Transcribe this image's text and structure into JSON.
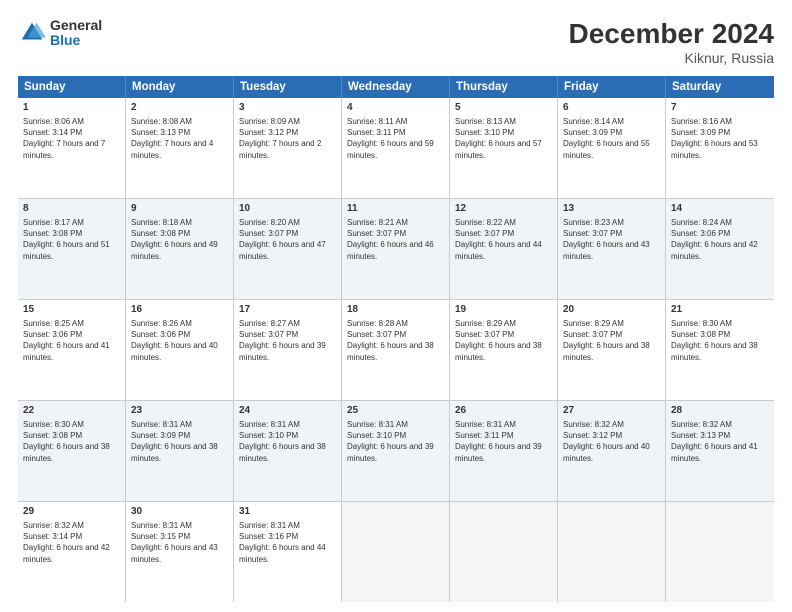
{
  "logo": {
    "general": "General",
    "blue": "Blue"
  },
  "header": {
    "month": "December 2024",
    "location": "Kiknur, Russia"
  },
  "days": [
    "Sunday",
    "Monday",
    "Tuesday",
    "Wednesday",
    "Thursday",
    "Friday",
    "Saturday"
  ],
  "weeks": [
    [
      {
        "day": "1",
        "sunrise": "8:06 AM",
        "sunset": "3:14 PM",
        "daylight": "7 hours and 7 minutes."
      },
      {
        "day": "2",
        "sunrise": "8:08 AM",
        "sunset": "3:13 PM",
        "daylight": "7 hours and 4 minutes."
      },
      {
        "day": "3",
        "sunrise": "8:09 AM",
        "sunset": "3:12 PM",
        "daylight": "7 hours and 2 minutes."
      },
      {
        "day": "4",
        "sunrise": "8:11 AM",
        "sunset": "3:11 PM",
        "daylight": "6 hours and 59 minutes."
      },
      {
        "day": "5",
        "sunrise": "8:13 AM",
        "sunset": "3:10 PM",
        "daylight": "6 hours and 57 minutes."
      },
      {
        "day": "6",
        "sunrise": "8:14 AM",
        "sunset": "3:09 PM",
        "daylight": "6 hours and 55 minutes."
      },
      {
        "day": "7",
        "sunrise": "8:16 AM",
        "sunset": "3:09 PM",
        "daylight": "6 hours and 53 minutes."
      }
    ],
    [
      {
        "day": "8",
        "sunrise": "8:17 AM",
        "sunset": "3:08 PM",
        "daylight": "6 hours and 51 minutes."
      },
      {
        "day": "9",
        "sunrise": "8:18 AM",
        "sunset": "3:08 PM",
        "daylight": "6 hours and 49 minutes."
      },
      {
        "day": "10",
        "sunrise": "8:20 AM",
        "sunset": "3:07 PM",
        "daylight": "6 hours and 47 minutes."
      },
      {
        "day": "11",
        "sunrise": "8:21 AM",
        "sunset": "3:07 PM",
        "daylight": "6 hours and 46 minutes."
      },
      {
        "day": "12",
        "sunrise": "8:22 AM",
        "sunset": "3:07 PM",
        "daylight": "6 hours and 44 minutes."
      },
      {
        "day": "13",
        "sunrise": "8:23 AM",
        "sunset": "3:07 PM",
        "daylight": "6 hours and 43 minutes."
      },
      {
        "day": "14",
        "sunrise": "8:24 AM",
        "sunset": "3:06 PM",
        "daylight": "6 hours and 42 minutes."
      }
    ],
    [
      {
        "day": "15",
        "sunrise": "8:25 AM",
        "sunset": "3:06 PM",
        "daylight": "6 hours and 41 minutes."
      },
      {
        "day": "16",
        "sunrise": "8:26 AM",
        "sunset": "3:06 PM",
        "daylight": "6 hours and 40 minutes."
      },
      {
        "day": "17",
        "sunrise": "8:27 AM",
        "sunset": "3:07 PM",
        "daylight": "6 hours and 39 minutes."
      },
      {
        "day": "18",
        "sunrise": "8:28 AM",
        "sunset": "3:07 PM",
        "daylight": "6 hours and 38 minutes."
      },
      {
        "day": "19",
        "sunrise": "8:29 AM",
        "sunset": "3:07 PM",
        "daylight": "6 hours and 38 minutes."
      },
      {
        "day": "20",
        "sunrise": "8:29 AM",
        "sunset": "3:07 PM",
        "daylight": "6 hours and 38 minutes."
      },
      {
        "day": "21",
        "sunrise": "8:30 AM",
        "sunset": "3:08 PM",
        "daylight": "6 hours and 38 minutes."
      }
    ],
    [
      {
        "day": "22",
        "sunrise": "8:30 AM",
        "sunset": "3:08 PM",
        "daylight": "6 hours and 38 minutes."
      },
      {
        "day": "23",
        "sunrise": "8:31 AM",
        "sunset": "3:09 PM",
        "daylight": "6 hours and 38 minutes."
      },
      {
        "day": "24",
        "sunrise": "8:31 AM",
        "sunset": "3:10 PM",
        "daylight": "6 hours and 38 minutes."
      },
      {
        "day": "25",
        "sunrise": "8:31 AM",
        "sunset": "3:10 PM",
        "daylight": "6 hours and 39 minutes."
      },
      {
        "day": "26",
        "sunrise": "8:31 AM",
        "sunset": "3:11 PM",
        "daylight": "6 hours and 39 minutes."
      },
      {
        "day": "27",
        "sunrise": "8:32 AM",
        "sunset": "3:12 PM",
        "daylight": "6 hours and 40 minutes."
      },
      {
        "day": "28",
        "sunrise": "8:32 AM",
        "sunset": "3:13 PM",
        "daylight": "6 hours and 41 minutes."
      }
    ],
    [
      {
        "day": "29",
        "sunrise": "8:32 AM",
        "sunset": "3:14 PM",
        "daylight": "6 hours and 42 minutes."
      },
      {
        "day": "30",
        "sunrise": "8:31 AM",
        "sunset": "3:15 PM",
        "daylight": "6 hours and 43 minutes."
      },
      {
        "day": "31",
        "sunrise": "8:31 AM",
        "sunset": "3:16 PM",
        "daylight": "6 hours and 44 minutes."
      },
      null,
      null,
      null,
      null
    ]
  ]
}
